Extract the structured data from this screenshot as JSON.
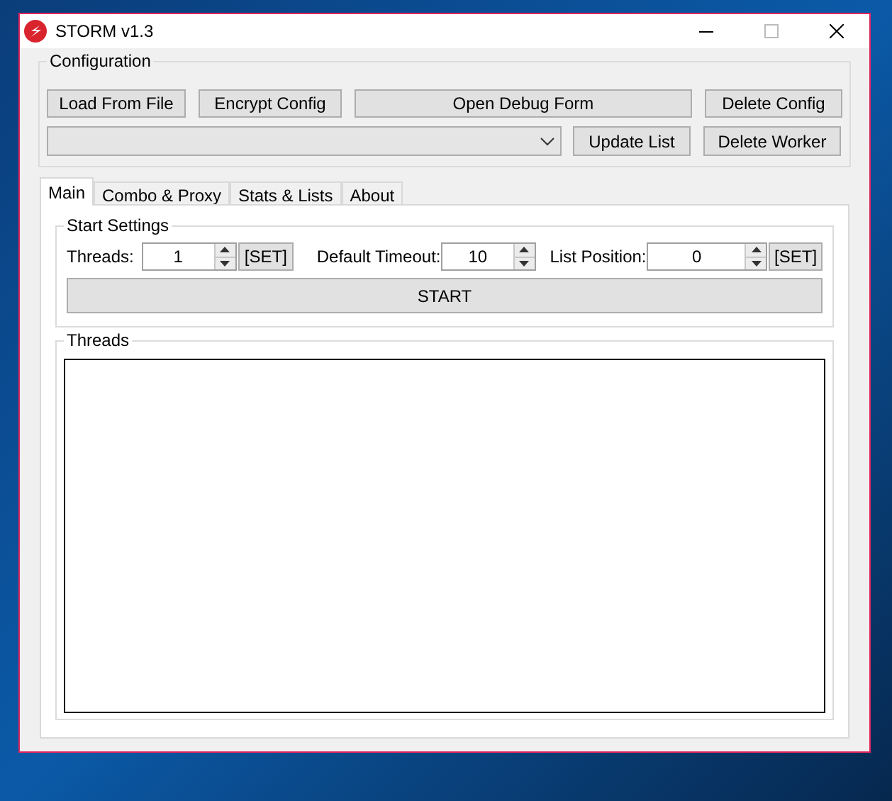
{
  "window": {
    "title": "STORM v1.3"
  },
  "configuration": {
    "title": "Configuration",
    "buttons": [
      "Load From File",
      "Encrypt Config",
      "Open Debug Form",
      "Delete Config"
    ],
    "update_button": "Update List",
    "delete_worker_button": "Delete Worker"
  },
  "tabs": [
    {
      "label": "Main",
      "selected": true
    },
    {
      "label": "Combo & Proxy",
      "selected": false
    },
    {
      "label": "Stats & Lists",
      "selected": false
    },
    {
      "label": "About",
      "selected": false
    }
  ],
  "start_settings": {
    "title": "Start Settings",
    "threads": {
      "label": "Threads:",
      "value": "1",
      "set_button": "[SET]"
    },
    "timeout": {
      "label": "Default Timeout:",
      "value": "10"
    },
    "list_position": {
      "label": "List Position:",
      "value": "0",
      "set_button": "[SET]"
    },
    "start_button": "START"
  },
  "threads_panel": {
    "title": "Threads"
  }
}
